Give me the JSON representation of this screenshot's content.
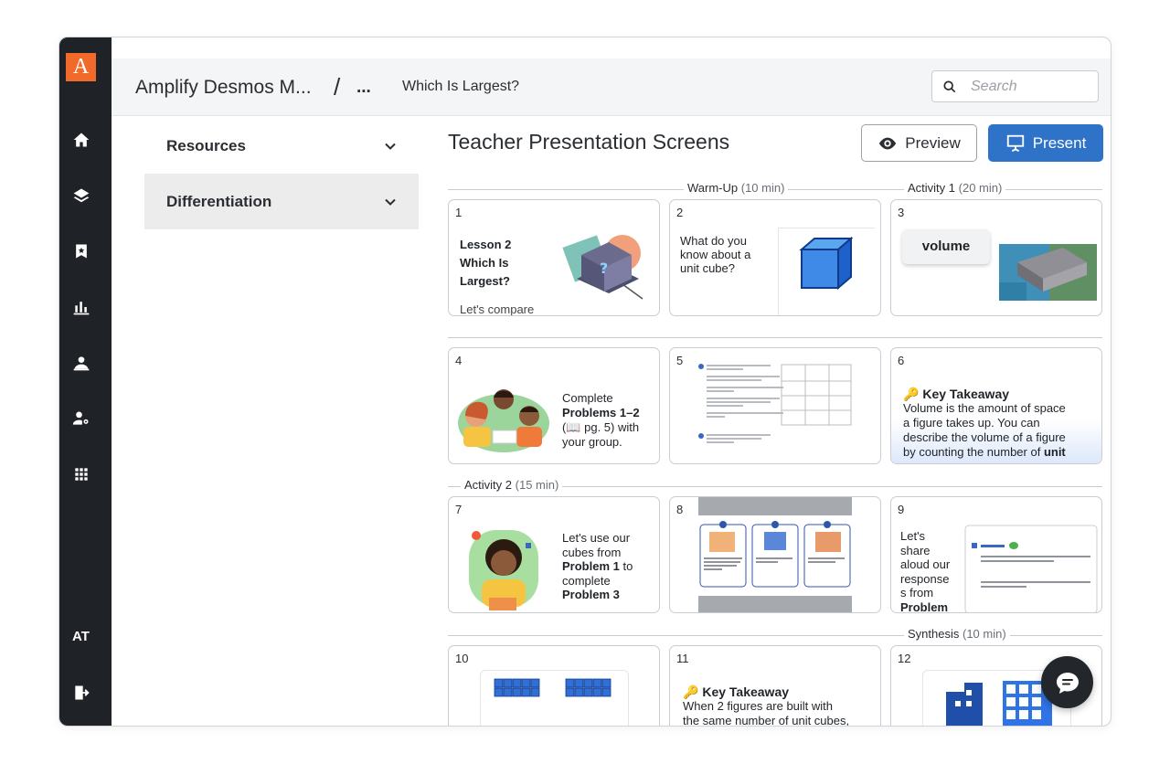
{
  "app": {
    "logo_letter": "A",
    "user_initials": "AT"
  },
  "breadcrumb": {
    "course": "Amplify Desmos M...",
    "separator": "/",
    "more": "...",
    "lesson": "Which Is Largest?"
  },
  "search": {
    "placeholder": "Search"
  },
  "sidebar": {
    "sections": [
      {
        "label": "Resources"
      },
      {
        "label": "Differentiation"
      }
    ]
  },
  "main": {
    "title": "Teacher Presentation Screens",
    "preview_label": "Preview",
    "present_label": "Present"
  },
  "segments": {
    "warmup": {
      "name": "Warm-Up",
      "duration": "(10 min)"
    },
    "activity1": {
      "name": "Activity 1",
      "duration": "(20 min)"
    },
    "activity2": {
      "name": "Activity 2",
      "duration": "(15 min)"
    },
    "synthesis": {
      "name": "Synthesis",
      "duration": "(10 min)"
    }
  },
  "cards": {
    "c1": {
      "num": "1",
      "title_l1": "Lesson 2",
      "title_l2": "Which Is",
      "title_l3": "Largest?",
      "sub": "Let's compare"
    },
    "c2": {
      "num": "2",
      "l1": "What do you",
      "l2": "know about a",
      "l3": "unit cube?"
    },
    "c3": {
      "num": "3",
      "word": "volume"
    },
    "c4": {
      "num": "4",
      "l1": "Complete",
      "bold": "Problems 1–2",
      "l2": "(📖 pg. 5) with",
      "l3": "your group."
    },
    "c5": {
      "num": "5"
    },
    "c6": {
      "num": "6",
      "heading": "Key Takeaway",
      "l1": "Volume is the amount of space",
      "l2": "a figure takes up. You can",
      "l3": "describe the volume of a figure",
      "l4a": "by counting the number of ",
      "l4b": "unit"
    },
    "c7": {
      "num": "7",
      "l1": "Let's use our",
      "l2": "cubes from",
      "l3a": "Problem 1",
      "l3b": " to",
      "l4": "complete",
      "l5": "Problem 3"
    },
    "c8": {
      "num": "8"
    },
    "c9": {
      "num": "9",
      "l1": "Let's",
      "l2": "share",
      "l3": "aloud our",
      "l4": "response",
      "l5": "s from",
      "l6": "Problem"
    },
    "c10": {
      "num": "10"
    },
    "c11": {
      "num": "11",
      "heading": "Key Takeaway",
      "l1": "When 2 figures are built with",
      "l2": "the same number of unit cubes,"
    },
    "c12": {
      "num": "12"
    }
  },
  "icons": {
    "nav": [
      "home-icon",
      "layers-icon",
      "bookmark-icon",
      "chart-icon",
      "teacher-icon",
      "admin-icon",
      "apps-icon",
      "logout-icon"
    ],
    "chat": "chat-icon"
  },
  "colors": {
    "accent": "#2f73c9",
    "brand": "#f26a2a",
    "rail": "#1f2327"
  }
}
